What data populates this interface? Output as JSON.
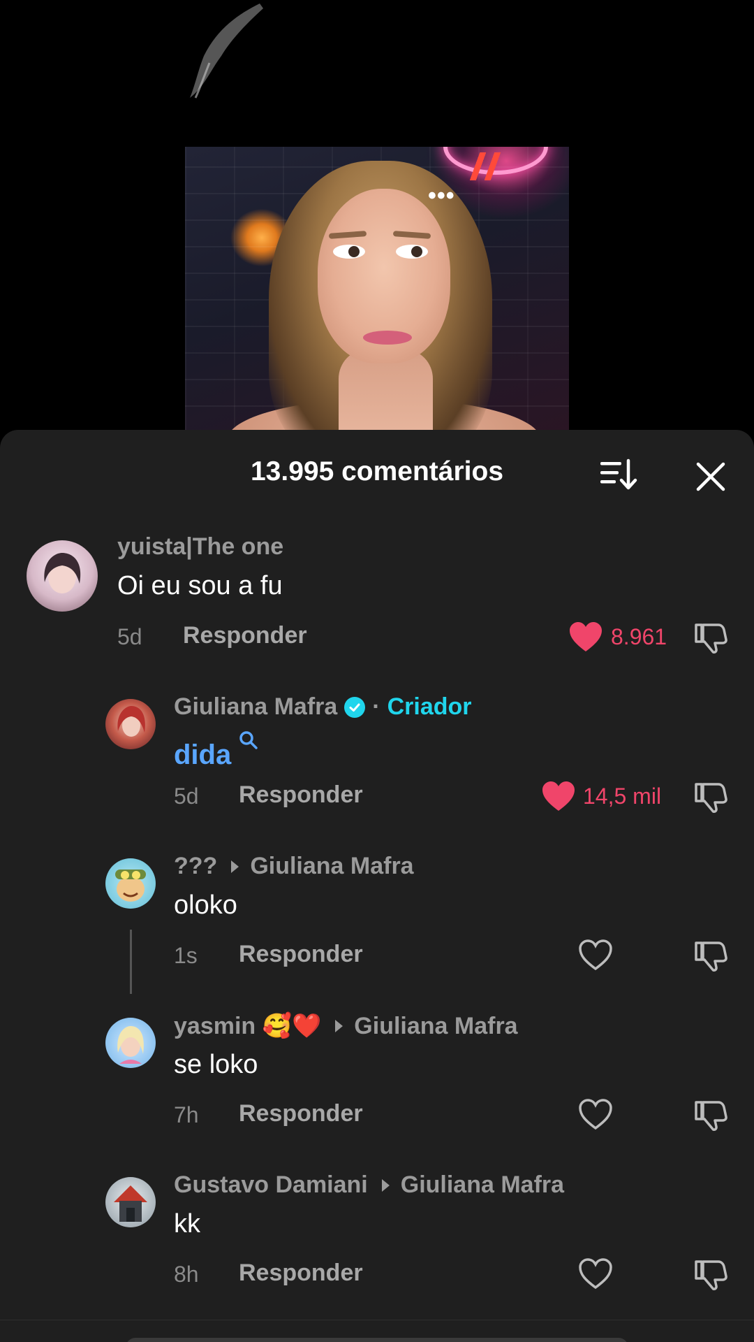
{
  "video": {
    "more_label": "•••"
  },
  "sheet": {
    "title": "13.995 comentários",
    "sort_icon": "sort-descending-icon",
    "close_icon": "close-icon"
  },
  "comments": [
    {
      "user": "yuista|The one",
      "text": "Oi eu sou a fu",
      "time": "5d",
      "reply": "Responder",
      "likes": "8.961",
      "liked": true
    },
    {
      "user": "Giuliana Mafra",
      "verified": true,
      "separator": "·",
      "creator_label": "Criador",
      "text": "dida",
      "text_icon": "search-icon",
      "time": "5d",
      "reply": "Responder",
      "likes": "14,5 mil",
      "liked": true
    },
    {
      "user": "???",
      "reply_to": "Giuliana Mafra",
      "text": "oloko",
      "time": "1s",
      "reply": "Responder",
      "likes": "",
      "liked": false
    },
    {
      "user": "yasmin 🥰❤️",
      "reply_to": "Giuliana Mafra",
      "text": "se loko",
      "time": "7h",
      "reply": "Responder",
      "likes": "",
      "liked": false
    },
    {
      "user": "Gustavo Damiani",
      "reply_to": "Giuliana Mafra",
      "text": "kk",
      "time": "8h",
      "reply": "Responder",
      "likes": "",
      "liked": false
    }
  ],
  "colors": {
    "sheet_bg": "#1f1f1f",
    "like_red": "#f0456a",
    "creator_cyan": "#20d5ec",
    "mention_blue": "#5aa6ff"
  }
}
